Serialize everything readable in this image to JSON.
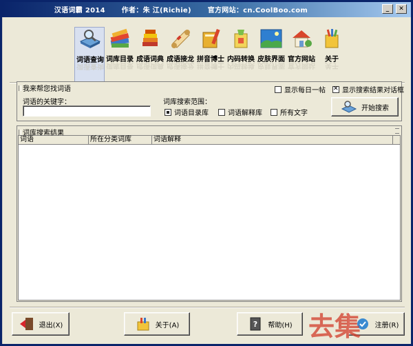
{
  "title_bar": {
    "app_name": "汉语词霸 2014",
    "author": "作者：朱 江(Richie)",
    "website": "官方网站：cn.CoolBoo.com",
    "minimize": "_",
    "close": "✕"
  },
  "toolbar": {
    "items": [
      {
        "label": "词语查询",
        "icon": "magnifier-book-icon",
        "active": true
      },
      {
        "label": "词库目录",
        "icon": "books-icon"
      },
      {
        "label": "成语词典",
        "icon": "book-stack-icon"
      },
      {
        "label": "成语接龙",
        "icon": "scroll-icon"
      },
      {
        "label": "拼音博士",
        "icon": "pencil-book-icon"
      },
      {
        "label": "内码转换",
        "icon": "convert-icon"
      },
      {
        "label": "皮肤界面",
        "icon": "landscape-icon"
      },
      {
        "label": "官方网站",
        "icon": "house-icon"
      },
      {
        "label": "关于",
        "icon": "info-icon"
      }
    ]
  },
  "search_panel": {
    "caption": "我来帮您找词语",
    "keyword_label": "词语的关键字：",
    "keyword_value": "",
    "scope_label": "词库搜索范围：",
    "scope_options": [
      {
        "label": "词语目录库",
        "checked": true
      },
      {
        "label": "词语解释库",
        "checked": false
      },
      {
        "label": "所有文字",
        "checked": false
      }
    ],
    "show_daily_tip": {
      "label": "显示每日一帖",
      "checked": false
    },
    "show_result_dialog": {
      "label": "显示搜索结果对话框",
      "checked": true
    },
    "search_button": "开始搜索"
  },
  "results_panel": {
    "caption": "词库搜索结果",
    "columns": [
      "词语",
      "所在分类词库",
      "词语解释"
    ]
  },
  "buttons": {
    "exit": "退出(X)",
    "about": "关于(A)",
    "help": "帮助(H)",
    "register": "注册(R)"
  },
  "colors": {
    "title_gradient_start": "#0a246a",
    "title_gradient_end": "#a6caf0",
    "face": "#ece9d8"
  },
  "watermark": "去集"
}
